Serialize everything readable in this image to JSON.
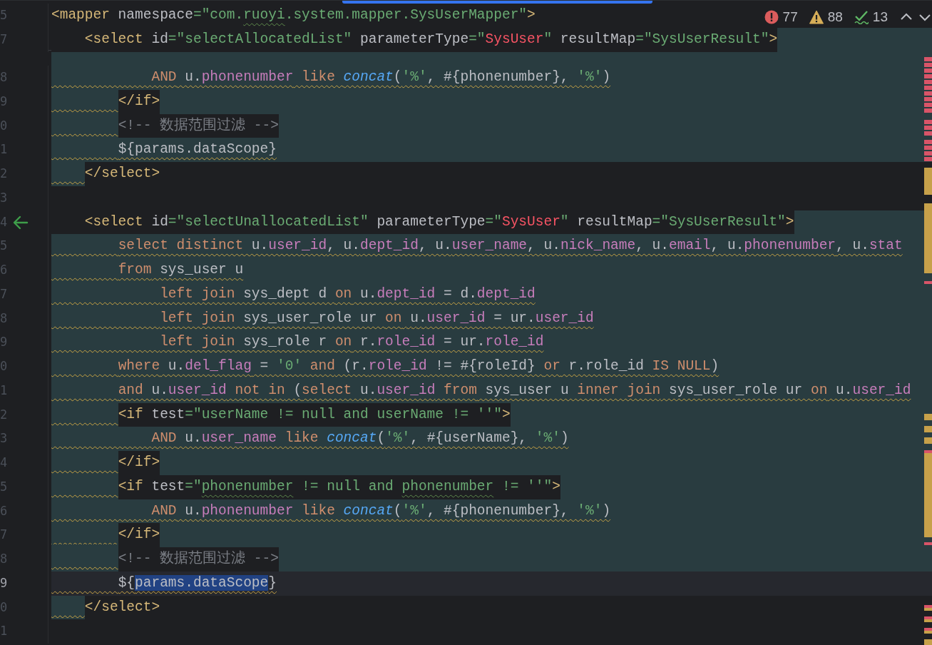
{
  "inspections": {
    "errors": "77",
    "warnings": "88",
    "typos": "13"
  },
  "sticky_lines": [
    {
      "number": "5",
      "kind": "plain",
      "tokens": [
        {
          "text": "<mapper",
          "kind": "tag"
        },
        {
          "text": " namespace",
          "kind": "attr"
        },
        {
          "text": "=\"com.",
          "kind": "str"
        },
        {
          "text": "ruoyi",
          "kind": "str",
          "typo": true
        },
        {
          "text": ".system.mapper.SysUserMapper\"",
          "kind": "str"
        },
        {
          "text": ">",
          "kind": "tag"
        }
      ]
    },
    {
      "number": "7",
      "kind": "open",
      "tokens": [
        {
          "text": "    <select",
          "kind": "tag"
        },
        {
          "text": " id",
          "kind": "attr"
        },
        {
          "text": "=\"selectAllocatedList\"",
          "kind": "str"
        },
        {
          "text": " parameterType",
          "kind": "attr"
        },
        {
          "text": "=\"",
          "kind": "str"
        },
        {
          "text": "SysUser",
          "kind": "err"
        },
        {
          "text": "\"",
          "kind": "str"
        },
        {
          "text": " resultMap",
          "kind": "attr"
        },
        {
          "text": "=\"SysUserResult\"",
          "kind": "str"
        },
        {
          "text": ">",
          "kind": "tag"
        }
      ]
    }
  ],
  "lines": [
    {
      "number": "8",
      "kind": "sql",
      "warning": true,
      "tokens": [
        {
          "text": "            AND",
          "kind": "kw"
        },
        {
          "text": " u.",
          "kind": "text"
        },
        {
          "text": "phonenumber",
          "kind": "field"
        },
        {
          "text": " like ",
          "kind": "kw"
        },
        {
          "text": "concat",
          "kind": "fn"
        },
        {
          "text": "(",
          "kind": "text"
        },
        {
          "text": "'%'",
          "kind": "str"
        },
        {
          "text": ", #{phonenumber}, ",
          "kind": "text"
        },
        {
          "text": "'%'",
          "kind": "str"
        },
        {
          "text": ")",
          "kind": "text"
        }
      ]
    },
    {
      "number": "9",
      "kind": "tag",
      "warning": true,
      "tokens": [
        {
          "text": "        </if>",
          "kind": "tag"
        }
      ]
    },
    {
      "number": "0",
      "kind": "tag",
      "warning": true,
      "tokens": [
        {
          "text": "        <!-- 数据范围过滤 -->",
          "kind": "comment"
        }
      ]
    },
    {
      "number": "1",
      "kind": "sql",
      "warning": true,
      "tokens": [
        {
          "text": "        ${params.dataScope}",
          "kind": "text"
        }
      ]
    },
    {
      "number": "2",
      "kind": "close",
      "warning": true,
      "tokens": [
        {
          "text": "    </select>",
          "kind": "tag"
        }
      ]
    },
    {
      "number": "3"
    },
    {
      "number": "4",
      "kind": "open",
      "warning": false,
      "marker": true,
      "tokens": [
        {
          "text": "    <select",
          "kind": "tag"
        },
        {
          "text": " id",
          "kind": "attr"
        },
        {
          "text": "=\"selectUnallocatedList\"",
          "kind": "str"
        },
        {
          "text": " parameterType",
          "kind": "attr"
        },
        {
          "text": "=\"",
          "kind": "str"
        },
        {
          "text": "SysUser",
          "kind": "err"
        },
        {
          "text": "\"",
          "kind": "str"
        },
        {
          "text": " resultMap",
          "kind": "attr"
        },
        {
          "text": "=\"SysUserResult\"",
          "kind": "str"
        },
        {
          "text": ">",
          "kind": "tag"
        }
      ]
    },
    {
      "number": "5",
      "kind": "sql",
      "warning": true,
      "tokens": [
        {
          "text": "        select distinct",
          "kind": "kw"
        },
        {
          "text": " u.",
          "kind": "text"
        },
        {
          "text": "user_id",
          "kind": "field"
        },
        {
          "text": ", u.",
          "kind": "text"
        },
        {
          "text": "dept_id",
          "kind": "field"
        },
        {
          "text": ", u.",
          "kind": "text"
        },
        {
          "text": "user_name",
          "kind": "field"
        },
        {
          "text": ", u.",
          "kind": "text"
        },
        {
          "text": "nick_name",
          "kind": "field"
        },
        {
          "text": ", u.",
          "kind": "text"
        },
        {
          "text": "email",
          "kind": "field"
        },
        {
          "text": ", u.",
          "kind": "text"
        },
        {
          "text": "phonenumber",
          "kind": "field"
        },
        {
          "text": ", u.",
          "kind": "text"
        },
        {
          "text": "stat",
          "kind": "field"
        }
      ]
    },
    {
      "number": "6",
      "kind": "sql",
      "warning": true,
      "tokens": [
        {
          "text": "        from",
          "kind": "kw"
        },
        {
          "text": " sys_user u",
          "kind": "text"
        }
      ]
    },
    {
      "number": "7",
      "kind": "sql",
      "warning": true,
      "tokens": [
        {
          "text": "             left join",
          "kind": "kw"
        },
        {
          "text": " sys_dept d ",
          "kind": "text"
        },
        {
          "text": "on",
          "kind": "kw"
        },
        {
          "text": " u.",
          "kind": "text"
        },
        {
          "text": "dept_id",
          "kind": "field"
        },
        {
          "text": " = d.",
          "kind": "text"
        },
        {
          "text": "dept_id",
          "kind": "field"
        }
      ]
    },
    {
      "number": "8",
      "kind": "sql",
      "warning": true,
      "tokens": [
        {
          "text": "             left join",
          "kind": "kw"
        },
        {
          "text": " sys_user_role ur ",
          "kind": "text"
        },
        {
          "text": "on",
          "kind": "kw"
        },
        {
          "text": " u.",
          "kind": "text"
        },
        {
          "text": "user_id",
          "kind": "field"
        },
        {
          "text": " = ur.",
          "kind": "text"
        },
        {
          "text": "user_id",
          "kind": "field"
        }
      ]
    },
    {
      "number": "9",
      "kind": "sql",
      "warning": true,
      "tokens": [
        {
          "text": "             left join",
          "kind": "kw"
        },
        {
          "text": " sys_role r ",
          "kind": "text"
        },
        {
          "text": "on",
          "kind": "kw"
        },
        {
          "text": " r.",
          "kind": "text"
        },
        {
          "text": "role_id",
          "kind": "field"
        },
        {
          "text": " = ur.",
          "kind": "text"
        },
        {
          "text": "role_id",
          "kind": "field"
        }
      ]
    },
    {
      "number": "0",
      "kind": "sql",
      "warning": true,
      "tokens": [
        {
          "text": "        where",
          "kind": "kw"
        },
        {
          "text": " u.",
          "kind": "text"
        },
        {
          "text": "del_flag",
          "kind": "field"
        },
        {
          "text": " = ",
          "kind": "text"
        },
        {
          "text": "'0'",
          "kind": "str"
        },
        {
          "text": " and",
          "kind": "kw"
        },
        {
          "text": " (r.",
          "kind": "text"
        },
        {
          "text": "role_id",
          "kind": "field"
        },
        {
          "text": " != #{roleId} ",
          "kind": "text"
        },
        {
          "text": "or",
          "kind": "kw"
        },
        {
          "text": " r.role_id ",
          "kind": "text"
        },
        {
          "text": "IS NULL",
          "kind": "kw"
        },
        {
          "text": ")",
          "kind": "text"
        }
      ]
    },
    {
      "number": "1",
      "kind": "sql",
      "warning": true,
      "tokens": [
        {
          "text": "        and",
          "kind": "kw"
        },
        {
          "text": " u.",
          "kind": "text"
        },
        {
          "text": "user_id",
          "kind": "field"
        },
        {
          "text": " not in",
          "kind": "kw"
        },
        {
          "text": " (",
          "kind": "text"
        },
        {
          "text": "select",
          "kind": "kw"
        },
        {
          "text": " u.",
          "kind": "text"
        },
        {
          "text": "user_id",
          "kind": "field"
        },
        {
          "text": " from",
          "kind": "kw"
        },
        {
          "text": " sys_user u ",
          "kind": "text"
        },
        {
          "text": "inner join",
          "kind": "kw"
        },
        {
          "text": " sys_user_role ur ",
          "kind": "text"
        },
        {
          "text": "on",
          "kind": "kw"
        },
        {
          "text": " u.",
          "kind": "text"
        },
        {
          "text": "user_id",
          "kind": "field"
        }
      ]
    },
    {
      "number": "2",
      "kind": "tag",
      "warning": true,
      "tokens": [
        {
          "text": "        <if",
          "kind": "tag"
        },
        {
          "text": " test",
          "kind": "attr"
        },
        {
          "text": "=\"userName != null and userName != ''\"",
          "kind": "str"
        },
        {
          "text": ">",
          "kind": "tag"
        }
      ]
    },
    {
      "number": "3",
      "kind": "sql",
      "warning": true,
      "tokens": [
        {
          "text": "            AND",
          "kind": "kw"
        },
        {
          "text": " u.",
          "kind": "text"
        },
        {
          "text": "user_name",
          "kind": "field"
        },
        {
          "text": " like ",
          "kind": "kw"
        },
        {
          "text": "concat",
          "kind": "fn"
        },
        {
          "text": "(",
          "kind": "text"
        },
        {
          "text": "'%'",
          "kind": "str"
        },
        {
          "text": ", #{userName}, ",
          "kind": "text"
        },
        {
          "text": "'%'",
          "kind": "str"
        },
        {
          "text": ")",
          "kind": "text"
        }
      ]
    },
    {
      "number": "4",
      "kind": "tag",
      "warning": true,
      "tokens": [
        {
          "text": "        </if>",
          "kind": "tag"
        }
      ]
    },
    {
      "number": "5",
      "kind": "tag",
      "warning": true,
      "tokens": [
        {
          "text": "        <if",
          "kind": "tag"
        },
        {
          "text": " test",
          "kind": "attr"
        },
        {
          "text": "=\"",
          "kind": "str"
        },
        {
          "text": "phonenumber",
          "kind": "str",
          "typo": true
        },
        {
          "text": " != null and ",
          "kind": "str"
        },
        {
          "text": "phonenumber",
          "kind": "str",
          "typo": true
        },
        {
          "text": " != ''\"",
          "kind": "str"
        },
        {
          "text": ">",
          "kind": "tag"
        }
      ]
    },
    {
      "number": "6",
      "kind": "sql",
      "warning": true,
      "tokens": [
        {
          "text": "            AND",
          "kind": "kw"
        },
        {
          "text": " u.",
          "kind": "text"
        },
        {
          "text": "phonenumber",
          "kind": "field"
        },
        {
          "text": " like ",
          "kind": "kw"
        },
        {
          "text": "concat",
          "kind": "fn"
        },
        {
          "text": "(",
          "kind": "text"
        },
        {
          "text": "'%'",
          "kind": "str"
        },
        {
          "text": ", #{phonenumber}, ",
          "kind": "text"
        },
        {
          "text": "'%'",
          "kind": "str"
        },
        {
          "text": ")",
          "kind": "text"
        }
      ]
    },
    {
      "number": "7",
      "kind": "tag",
      "warning": true,
      "tokens": [
        {
          "text": "        </if>",
          "kind": "tag"
        }
      ]
    },
    {
      "number": "8",
      "kind": "tag",
      "warning": true,
      "tokens": [
        {
          "text": "        <!-- 数据范围过滤 -->",
          "kind": "comment"
        }
      ]
    },
    {
      "number": "9",
      "kind": "plain",
      "warning": true,
      "current": true,
      "tokens": [
        {
          "text": "        ${",
          "kind": "text"
        },
        {
          "text": "params.dataScope",
          "kind": "text",
          "selected": true
        },
        {
          "text": "}",
          "kind": "text"
        }
      ]
    },
    {
      "number": "0",
      "kind": "close",
      "warning": true,
      "tokens": [
        {
          "text": "    </select>",
          "kind": "tag"
        }
      ]
    },
    {
      "number": "1"
    }
  ]
}
